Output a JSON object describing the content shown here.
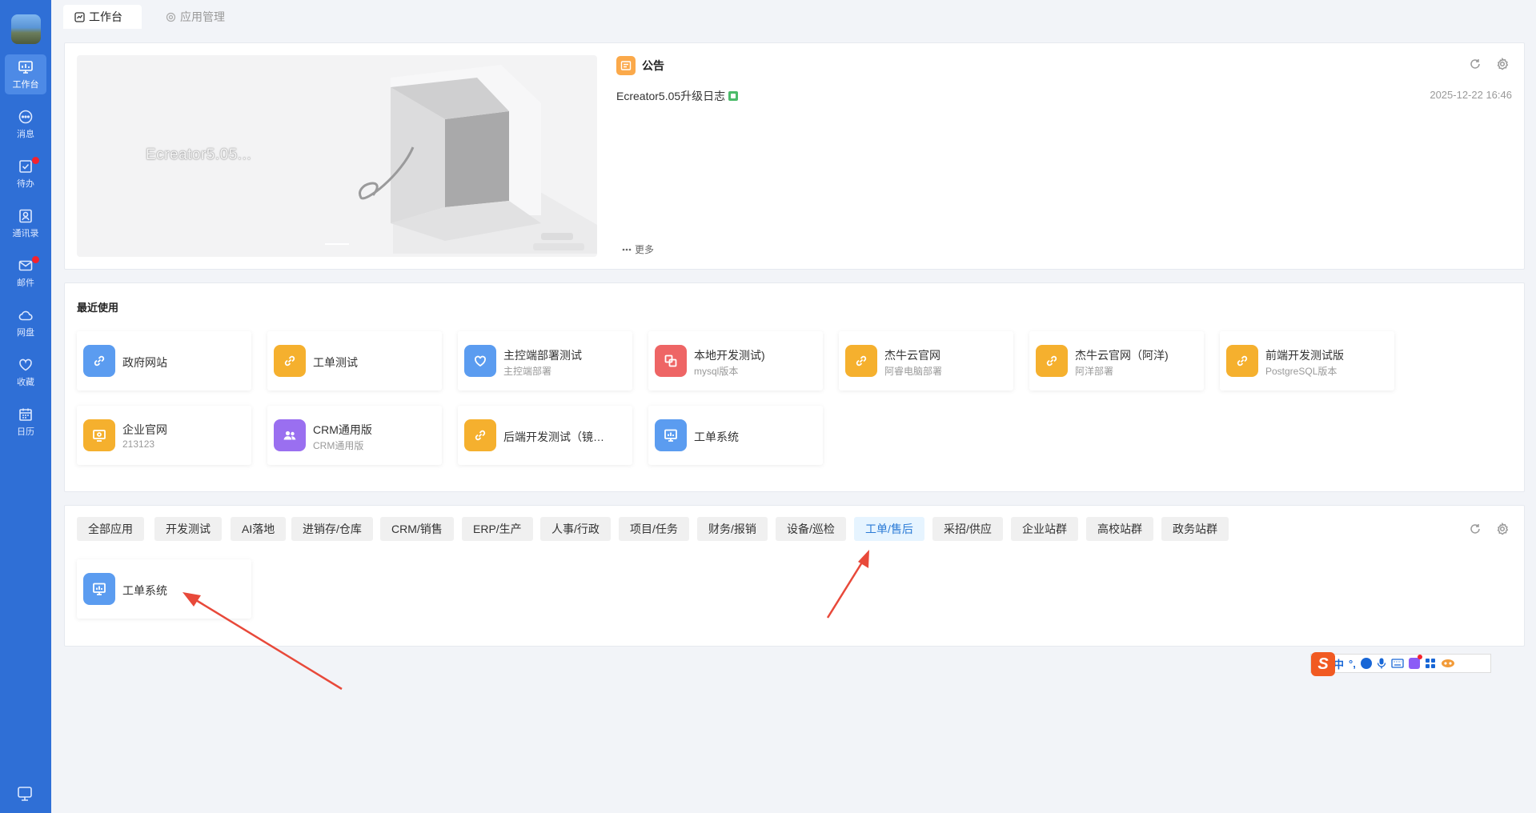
{
  "sidebar": {
    "items": [
      {
        "label": "工作台",
        "icon": "monitor-icon"
      },
      {
        "label": "消息",
        "icon": "chat-icon"
      },
      {
        "label": "待办",
        "icon": "checkbox-icon"
      },
      {
        "label": "通讯录",
        "icon": "contacts-icon"
      },
      {
        "label": "邮件",
        "icon": "mail-icon"
      },
      {
        "label": "网盘",
        "icon": "cloud-icon"
      },
      {
        "label": "收藏",
        "icon": "heart-icon"
      },
      {
        "label": "日历",
        "icon": "calendar-icon"
      }
    ],
    "active_index": 0,
    "badge_items": [
      2,
      4
    ]
  },
  "tabs": [
    {
      "label": "工作台",
      "icon": "dashboard-icon",
      "active": true
    },
    {
      "label": "应用管理",
      "icon": "gear-icon",
      "active": false
    }
  ],
  "banner": {
    "title": "Ecreator5.05..."
  },
  "notice": {
    "title": "公告",
    "items": [
      {
        "title": "Ecreator5.05升级日志",
        "date": "2025-12-22 16:46"
      }
    ],
    "more_label": "更多"
  },
  "recent": {
    "title": "最近使用",
    "apps": [
      {
        "name": "政府网站",
        "sub": "",
        "icon": "link-icon",
        "color": "#5b9cf0"
      },
      {
        "name": "工单测试",
        "sub": "",
        "icon": "link-icon",
        "color": "#f5b02e"
      },
      {
        "name": "主控端部署测试",
        "sub": "主控端部署",
        "icon": "heart-outline-icon",
        "color": "#5b9cf0"
      },
      {
        "name": "本地开发测试)",
        "sub": "mysql版本",
        "icon": "windows-icon",
        "color": "#ee6565"
      },
      {
        "name": "杰牛云官网",
        "sub": "阿睿电脑部署",
        "icon": "link-icon",
        "color": "#f5b02e"
      },
      {
        "name": "杰牛云官网（阿洋)",
        "sub": "阿洋部署",
        "icon": "link-icon",
        "color": "#f5b02e"
      },
      {
        "name": "前端开发测试版",
        "sub": "PostgreSQL版本",
        "icon": "link-icon",
        "color": "#f5b02e"
      },
      {
        "name": "企业官网",
        "sub": "213123",
        "icon": "monitor-icon",
        "color": "#f5b02e"
      },
      {
        "name": "CRM通用版",
        "sub": "CRM通用版",
        "icon": "users-icon",
        "color": "#9a6ff0"
      },
      {
        "name": "后端开发测试（镜…",
        "sub": "",
        "icon": "link-icon",
        "color": "#f5b02e"
      },
      {
        "name": "工单系统",
        "sub": "",
        "icon": "chart-board-icon",
        "color": "#5b9cf0"
      }
    ]
  },
  "categories": {
    "items": [
      "全部应用",
      "开发测试",
      "AI落地",
      "进销存/仓库",
      "CRM/销售",
      "ERP/生产",
      "人事/行政",
      "项目/任务",
      "财务/报销",
      "设备/巡检",
      "工单/售后",
      "采招/供应",
      "企业站群",
      "高校站群",
      "政务站群"
    ],
    "active_index": 10,
    "apps": [
      {
        "name": "工单系统",
        "sub": "",
        "icon": "chart-board-icon",
        "color": "#5b9cf0"
      }
    ]
  },
  "ime": {
    "logo": "S",
    "items": [
      "中",
      "°,"
    ]
  },
  "colors": {
    "sidebar": "#2f6fd6",
    "accent": "#2a7ad6",
    "arrow": "#e8493a"
  }
}
